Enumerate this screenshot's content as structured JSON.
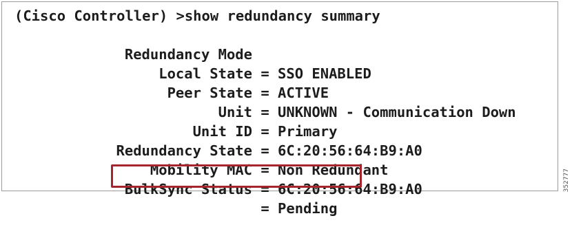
{
  "terminal": {
    "prompt": "(Cisco Controller) >show redundancy summary",
    "rows": [
      {
        "label": "Redundancy Mode",
        "value": "SSO ENABLED"
      },
      {
        "label": "Local State",
        "value": "ACTIVE"
      },
      {
        "label": "Peer State",
        "value": "UNKNOWN - Communication Down"
      },
      {
        "label": "Unit",
        "value": "Primary"
      },
      {
        "label": "Unit ID",
        "value": "6C:20:56:64:B9:A0"
      },
      {
        "label": "Redundancy State",
        "value": "Non Redundant"
      },
      {
        "label": "Mobility MAC",
        "value": "6C:20:56:64:B9:A0"
      },
      {
        "label": "BulkSync Status",
        "value": "Pending"
      }
    ],
    "separator": " = "
  },
  "highlight": {
    "row": "BulkSync Status",
    "color": "#a4262c"
  },
  "figure_id": "352777"
}
